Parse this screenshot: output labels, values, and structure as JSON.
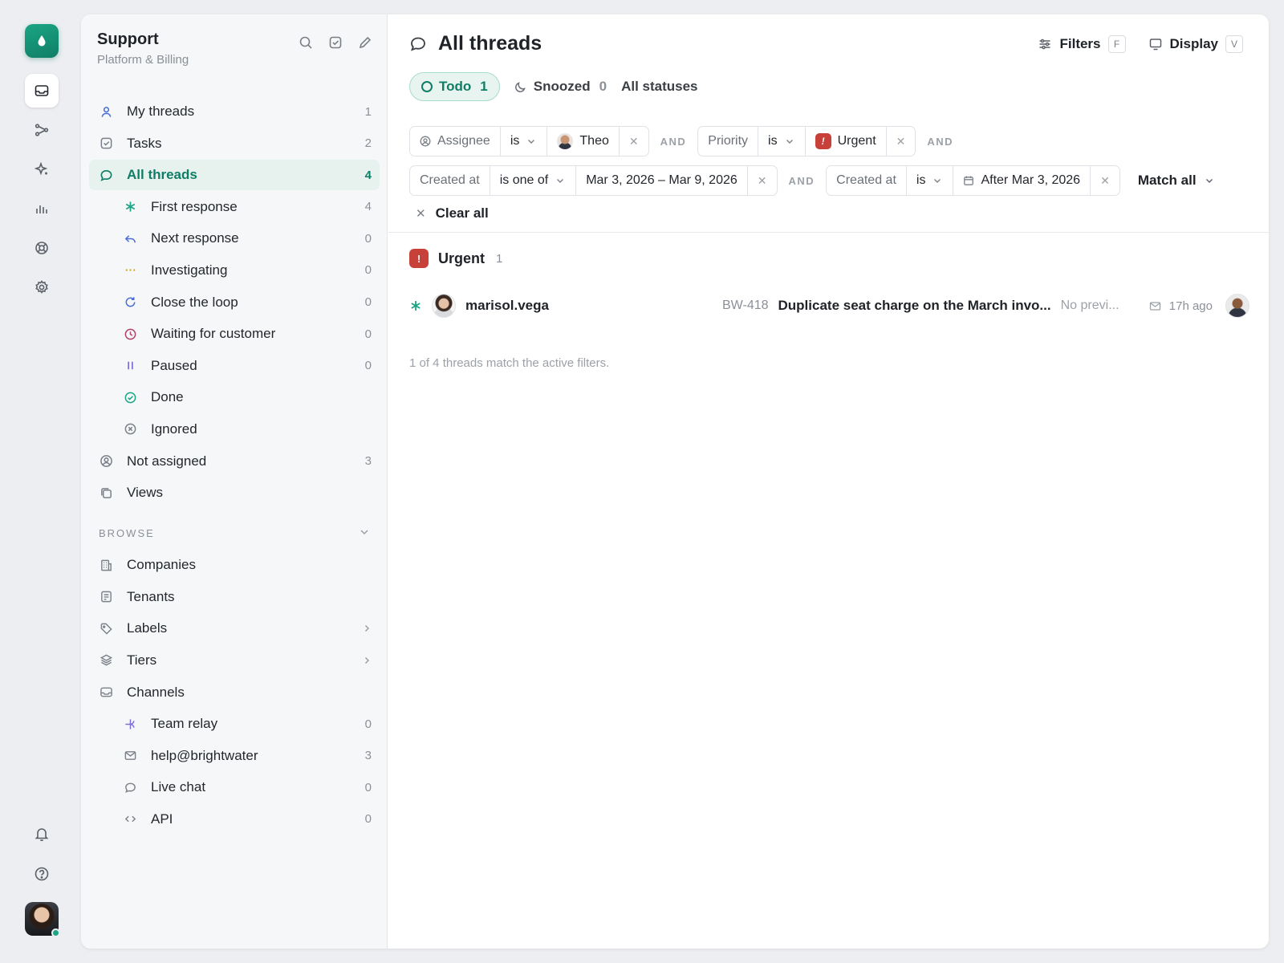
{
  "sidebar": {
    "title": "Support",
    "subtitle": "Platform & Billing",
    "items": [
      {
        "label": "My threads",
        "count": "1"
      },
      {
        "label": "Tasks",
        "count": "2"
      },
      {
        "label": "All threads",
        "count": "4"
      },
      {
        "label": "First response",
        "count": "4"
      },
      {
        "label": "Next response",
        "count": "0"
      },
      {
        "label": "Investigating",
        "count": "0"
      },
      {
        "label": "Close the loop",
        "count": "0"
      },
      {
        "label": "Waiting for customer",
        "count": "0"
      },
      {
        "label": "Paused",
        "count": "0"
      },
      {
        "label": "Done",
        "count": ""
      },
      {
        "label": "Ignored",
        "count": ""
      },
      {
        "label": "Not assigned",
        "count": "3"
      },
      {
        "label": "Views",
        "count": ""
      }
    ],
    "browse_label": "BROWSE",
    "browse": [
      {
        "label": "Companies"
      },
      {
        "label": "Tenants"
      },
      {
        "label": "Labels"
      },
      {
        "label": "Tiers"
      },
      {
        "label": "Channels"
      },
      {
        "label": "Team relay",
        "count": "0"
      },
      {
        "label": "help@brightwater",
        "count": "3"
      },
      {
        "label": "Live chat",
        "count": "0"
      },
      {
        "label": "API",
        "count": "0"
      }
    ]
  },
  "main": {
    "title": "All threads",
    "filters_btn": "Filters",
    "filters_key": "F",
    "display_btn": "Display",
    "display_key": "V",
    "tabs": [
      {
        "label": "Todo",
        "count": "1"
      },
      {
        "label": "Snoozed",
        "count": "0"
      },
      {
        "label": "All statuses"
      }
    ],
    "filter1": {
      "field": "Assignee",
      "op": "is",
      "value": "Theo"
    },
    "and_label": "AND",
    "filter2": {
      "field": "Priority",
      "op": "is",
      "value": "Urgent"
    },
    "filter3": {
      "field": "Created at",
      "op": "is one of",
      "value": "Mar 3, 2026 – Mar 9, 2026"
    },
    "filter4": {
      "field": "Created at",
      "op": "is",
      "value": "After Mar 3, 2026"
    },
    "match_all": "Match all",
    "clear_all": "Clear all",
    "group": {
      "label": "Urgent",
      "count": "1"
    },
    "thread": {
      "customer": "marisol.vega",
      "id": "BW-418",
      "title": "Duplicate seat charge on the March invo...",
      "preview": "No previ...",
      "time": "17h ago"
    },
    "match_note": "1 of 4 threads match the active filters."
  },
  "colors": {
    "accent": "#0f7e66",
    "urgent": "#c8403a"
  }
}
